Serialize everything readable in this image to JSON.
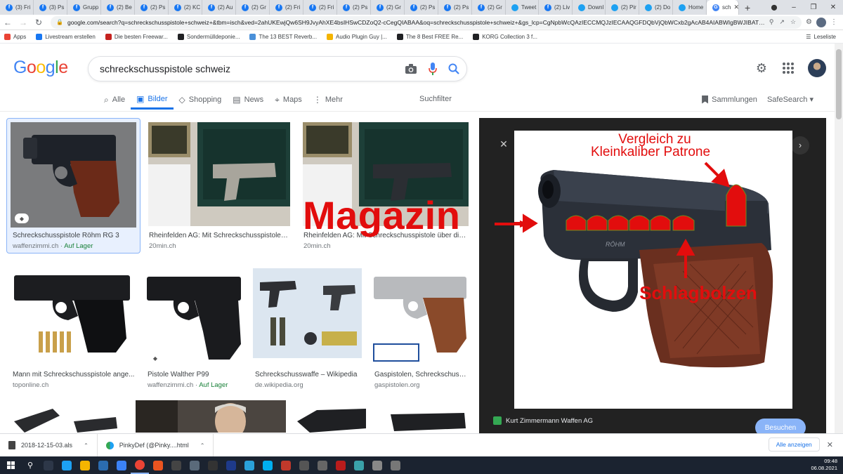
{
  "browser": {
    "tabs": [
      {
        "label": "(3) Fri",
        "icon": "facebook-icon",
        "color": "#1877f2"
      },
      {
        "label": "(3) Ps",
        "icon": "facebook-icon",
        "color": "#1877f2"
      },
      {
        "label": "Grupp",
        "icon": "facebook-icon",
        "color": "#1877f2"
      },
      {
        "label": "(2) Be",
        "icon": "facebook-icon",
        "color": "#1877f2"
      },
      {
        "label": "(2) Ps",
        "icon": "facebook-icon",
        "color": "#1877f2"
      },
      {
        "label": "(2) KC",
        "icon": "facebook-icon",
        "color": "#1877f2"
      },
      {
        "label": "(2) Au",
        "icon": "facebook-icon",
        "color": "#1877f2"
      },
      {
        "label": "(2) Gr",
        "icon": "facebook-icon",
        "color": "#1877f2"
      },
      {
        "label": "(2) Fri",
        "icon": "facebook-icon",
        "color": "#1877f2"
      },
      {
        "label": "(2) Fri",
        "icon": "facebook-icon",
        "color": "#1877f2"
      },
      {
        "label": "(2) Ps",
        "icon": "facebook-icon",
        "color": "#1877f2"
      },
      {
        "label": "(2) Gr",
        "icon": "facebook-icon",
        "color": "#1877f2"
      },
      {
        "label": "(2) Ps",
        "icon": "facebook-icon",
        "color": "#1877f2"
      },
      {
        "label": "(2) Ps",
        "icon": "facebook-icon",
        "color": "#1877f2"
      },
      {
        "label": "(2) Gr",
        "icon": "facebook-icon",
        "color": "#1877f2"
      },
      {
        "label": "Tweet",
        "icon": "twitter-icon",
        "color": "#1da1f2"
      },
      {
        "label": "(2) Liv",
        "icon": "facebook-icon",
        "color": "#1877f2"
      },
      {
        "label": "Downl",
        "icon": "twitter-icon",
        "color": "#1da1f2"
      },
      {
        "label": "(2) Pir",
        "icon": "twitter-icon",
        "color": "#1da1f2"
      },
      {
        "label": "(2) Do",
        "icon": "twitter-icon",
        "color": "#1da1f2"
      },
      {
        "label": "Home",
        "icon": "twitter-icon",
        "color": "#1da1f2"
      },
      {
        "label": "sch",
        "icon": "google-icon",
        "color": "#4285f4",
        "active": true
      }
    ],
    "url": "google.com/search?q=schreckschusspistole+schweiz+&tbm=isch&ved=2ahUKEwjQw6SH9JvyAhXE4bsIHSwCDZoQ2-cCegQIABAA&oq=schreckschusspistole+schweiz+&gs_lcp=CgNpbWcQAzIECCMQJzIECAAQGFDQbVjQbWCxb2gAcAB4AIABWIgBWJIBATGY...",
    "bookmarks": [
      {
        "label": "Apps",
        "color": "#ea4335"
      },
      {
        "label": "Livestream erstellen",
        "color": "#1877f2"
      },
      {
        "label": "Die besten Freewar...",
        "color": "#c5221f"
      },
      {
        "label": "Sondermülldeponie...",
        "color": "#202124"
      },
      {
        "label": "The 13 BEST Reverb...",
        "color": "#4a90d9"
      },
      {
        "label": "Audio Plugin Guy |...",
        "color": "#f4b400"
      },
      {
        "label": "The 8 Best FREE Re...",
        "color": "#202124"
      },
      {
        "label": "KORG Collection 3 f...",
        "color": "#202124"
      }
    ],
    "reading_list": "Leseliste"
  },
  "google": {
    "logo": [
      "G",
      "o",
      "o",
      "g",
      "l",
      "e"
    ],
    "logo_colors": [
      "#4285f4",
      "#ea4335",
      "#fbbc05",
      "#4285f4",
      "#34a853",
      "#ea4335"
    ],
    "query": "schreckschusspistole schweiz",
    "tabs": [
      {
        "label": "Alle",
        "icon": "search-icon"
      },
      {
        "label": "Bilder",
        "icon": "image-icon",
        "active": true
      },
      {
        "label": "Shopping",
        "icon": "tag-icon"
      },
      {
        "label": "News",
        "icon": "news-icon"
      },
      {
        "label": "Maps",
        "icon": "map-pin-icon"
      },
      {
        "label": "Mehr",
        "icon": "more-vert-icon"
      }
    ],
    "suchfilter": "Suchfilter",
    "sammlungen": "Sammlungen",
    "safesearch": "SafeSearch"
  },
  "results": [
    {
      "title": "Schreckschusspistole Röhm RG 3",
      "source": "waffenzimmi.ch",
      "stock": "Auf Lager",
      "selected": true
    },
    {
      "title": "Rheinfelden AG: Mit Schreckschusspistole ü...",
      "source": "20min.ch"
    },
    {
      "title": "Rheinfelden AG: Mit Schreckschusspistole über die ...",
      "source": "20min.ch"
    },
    {
      "title": "Mann mit Schreckschusspistole ange...",
      "source": "toponline.ch"
    },
    {
      "title": "Pistole Walther P99",
      "source": "waffenzimmi.ch",
      "stock": "Auf Lager"
    },
    {
      "title": "Schreckschusswaffe – Wikipedia",
      "source": "de.wikipedia.org"
    },
    {
      "title": "Gaspistolen, Schreckschuss...",
      "source": "gaspistolen.org"
    }
  ],
  "preview": {
    "annotations": {
      "vergleich": "Vergleich zu",
      "kleinkaliber": "Kleinkaliber Patrone",
      "magazin": "Magazin",
      "schlagbolzen": "Schlagbolzen"
    },
    "gun_brand": "RÖHM",
    "source": "Kurt Zimmermann Waffen AG",
    "visit_button": "Besuchen"
  },
  "downloads": [
    {
      "label": "2018-12-15-03.als"
    },
    {
      "label": "PinkyDef (@Pinky....html"
    }
  ],
  "downloads_all": "Alle anzeigen",
  "taskbar": {
    "time": "09:48",
    "date": "06.08.2021"
  }
}
